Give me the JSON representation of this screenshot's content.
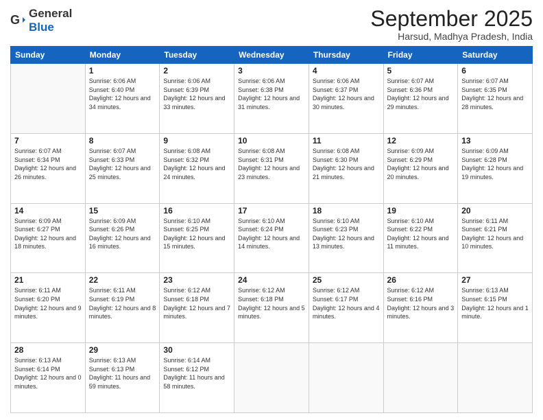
{
  "header": {
    "logo_general": "General",
    "logo_blue": "Blue",
    "month": "September 2025",
    "location": "Harsud, Madhya Pradesh, India"
  },
  "days_of_week": [
    "Sunday",
    "Monday",
    "Tuesday",
    "Wednesday",
    "Thursday",
    "Friday",
    "Saturday"
  ],
  "weeks": [
    [
      {
        "day": "",
        "sunrise": "",
        "sunset": "",
        "daylight": ""
      },
      {
        "day": "1",
        "sunrise": "Sunrise: 6:06 AM",
        "sunset": "Sunset: 6:40 PM",
        "daylight": "Daylight: 12 hours and 34 minutes."
      },
      {
        "day": "2",
        "sunrise": "Sunrise: 6:06 AM",
        "sunset": "Sunset: 6:39 PM",
        "daylight": "Daylight: 12 hours and 33 minutes."
      },
      {
        "day": "3",
        "sunrise": "Sunrise: 6:06 AM",
        "sunset": "Sunset: 6:38 PM",
        "daylight": "Daylight: 12 hours and 31 minutes."
      },
      {
        "day": "4",
        "sunrise": "Sunrise: 6:06 AM",
        "sunset": "Sunset: 6:37 PM",
        "daylight": "Daylight: 12 hours and 30 minutes."
      },
      {
        "day": "5",
        "sunrise": "Sunrise: 6:07 AM",
        "sunset": "Sunset: 6:36 PM",
        "daylight": "Daylight: 12 hours and 29 minutes."
      },
      {
        "day": "6",
        "sunrise": "Sunrise: 6:07 AM",
        "sunset": "Sunset: 6:35 PM",
        "daylight": "Daylight: 12 hours and 28 minutes."
      }
    ],
    [
      {
        "day": "7",
        "sunrise": "Sunrise: 6:07 AM",
        "sunset": "Sunset: 6:34 PM",
        "daylight": "Daylight: 12 hours and 26 minutes."
      },
      {
        "day": "8",
        "sunrise": "Sunrise: 6:07 AM",
        "sunset": "Sunset: 6:33 PM",
        "daylight": "Daylight: 12 hours and 25 minutes."
      },
      {
        "day": "9",
        "sunrise": "Sunrise: 6:08 AM",
        "sunset": "Sunset: 6:32 PM",
        "daylight": "Daylight: 12 hours and 24 minutes."
      },
      {
        "day": "10",
        "sunrise": "Sunrise: 6:08 AM",
        "sunset": "Sunset: 6:31 PM",
        "daylight": "Daylight: 12 hours and 23 minutes."
      },
      {
        "day": "11",
        "sunrise": "Sunrise: 6:08 AM",
        "sunset": "Sunset: 6:30 PM",
        "daylight": "Daylight: 12 hours and 21 minutes."
      },
      {
        "day": "12",
        "sunrise": "Sunrise: 6:09 AM",
        "sunset": "Sunset: 6:29 PM",
        "daylight": "Daylight: 12 hours and 20 minutes."
      },
      {
        "day": "13",
        "sunrise": "Sunrise: 6:09 AM",
        "sunset": "Sunset: 6:28 PM",
        "daylight": "Daylight: 12 hours and 19 minutes."
      }
    ],
    [
      {
        "day": "14",
        "sunrise": "Sunrise: 6:09 AM",
        "sunset": "Sunset: 6:27 PM",
        "daylight": "Daylight: 12 hours and 18 minutes."
      },
      {
        "day": "15",
        "sunrise": "Sunrise: 6:09 AM",
        "sunset": "Sunset: 6:26 PM",
        "daylight": "Daylight: 12 hours and 16 minutes."
      },
      {
        "day": "16",
        "sunrise": "Sunrise: 6:10 AM",
        "sunset": "Sunset: 6:25 PM",
        "daylight": "Daylight: 12 hours and 15 minutes."
      },
      {
        "day": "17",
        "sunrise": "Sunrise: 6:10 AM",
        "sunset": "Sunset: 6:24 PM",
        "daylight": "Daylight: 12 hours and 14 minutes."
      },
      {
        "day": "18",
        "sunrise": "Sunrise: 6:10 AM",
        "sunset": "Sunset: 6:23 PM",
        "daylight": "Daylight: 12 hours and 13 minutes."
      },
      {
        "day": "19",
        "sunrise": "Sunrise: 6:10 AM",
        "sunset": "Sunset: 6:22 PM",
        "daylight": "Daylight: 12 hours and 11 minutes."
      },
      {
        "day": "20",
        "sunrise": "Sunrise: 6:11 AM",
        "sunset": "Sunset: 6:21 PM",
        "daylight": "Daylight: 12 hours and 10 minutes."
      }
    ],
    [
      {
        "day": "21",
        "sunrise": "Sunrise: 6:11 AM",
        "sunset": "Sunset: 6:20 PM",
        "daylight": "Daylight: 12 hours and 9 minutes."
      },
      {
        "day": "22",
        "sunrise": "Sunrise: 6:11 AM",
        "sunset": "Sunset: 6:19 PM",
        "daylight": "Daylight: 12 hours and 8 minutes."
      },
      {
        "day": "23",
        "sunrise": "Sunrise: 6:12 AM",
        "sunset": "Sunset: 6:18 PM",
        "daylight": "Daylight: 12 hours and 7 minutes."
      },
      {
        "day": "24",
        "sunrise": "Sunrise: 6:12 AM",
        "sunset": "Sunset: 6:18 PM",
        "daylight": "Daylight: 12 hours and 5 minutes."
      },
      {
        "day": "25",
        "sunrise": "Sunrise: 6:12 AM",
        "sunset": "Sunset: 6:17 PM",
        "daylight": "Daylight: 12 hours and 4 minutes."
      },
      {
        "day": "26",
        "sunrise": "Sunrise: 6:12 AM",
        "sunset": "Sunset: 6:16 PM",
        "daylight": "Daylight: 12 hours and 3 minutes."
      },
      {
        "day": "27",
        "sunrise": "Sunrise: 6:13 AM",
        "sunset": "Sunset: 6:15 PM",
        "daylight": "Daylight: 12 hours and 1 minute."
      }
    ],
    [
      {
        "day": "28",
        "sunrise": "Sunrise: 6:13 AM",
        "sunset": "Sunset: 6:14 PM",
        "daylight": "Daylight: 12 hours and 0 minutes."
      },
      {
        "day": "29",
        "sunrise": "Sunrise: 6:13 AM",
        "sunset": "Sunset: 6:13 PM",
        "daylight": "Daylight: 11 hours and 59 minutes."
      },
      {
        "day": "30",
        "sunrise": "Sunrise: 6:14 AM",
        "sunset": "Sunset: 6:12 PM",
        "daylight": "Daylight: 11 hours and 58 minutes."
      },
      {
        "day": "",
        "sunrise": "",
        "sunset": "",
        "daylight": ""
      },
      {
        "day": "",
        "sunrise": "",
        "sunset": "",
        "daylight": ""
      },
      {
        "day": "",
        "sunrise": "",
        "sunset": "",
        "daylight": ""
      },
      {
        "day": "",
        "sunrise": "",
        "sunset": "",
        "daylight": ""
      }
    ]
  ]
}
